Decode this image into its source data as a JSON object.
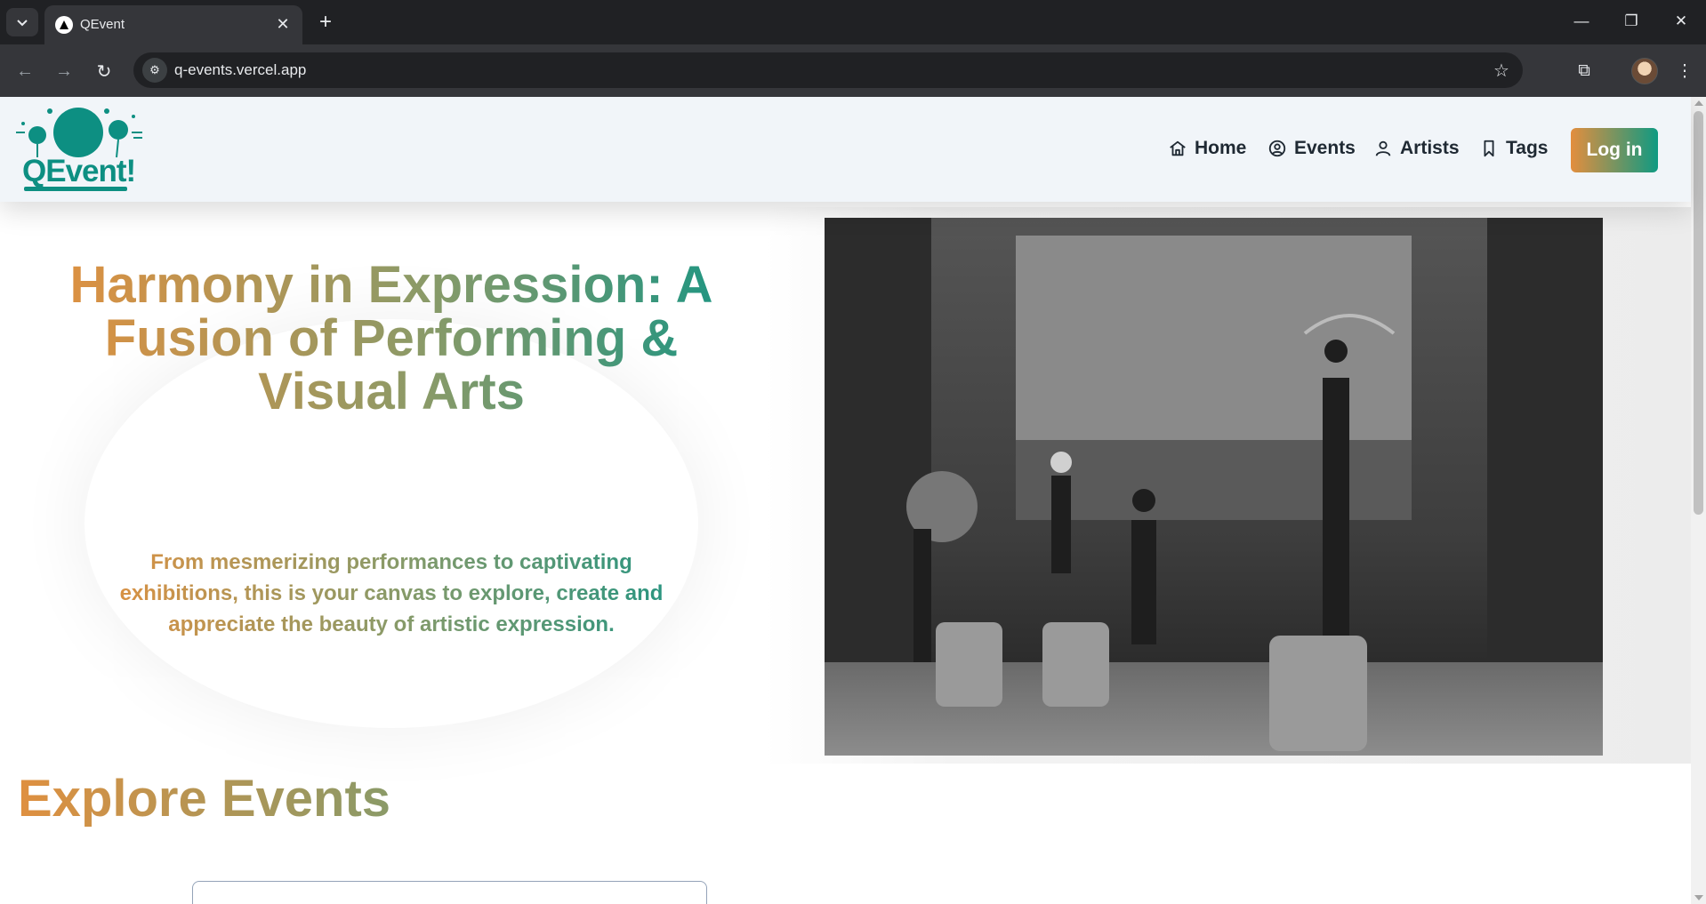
{
  "browser": {
    "tab_title": "QEvent",
    "url": "q-events.vercel.app"
  },
  "site": {
    "logo_text": "QEvent!",
    "nav": [
      {
        "label": "Home",
        "icon": "home-icon"
      },
      {
        "label": "Events",
        "icon": "user-circle-icon"
      },
      {
        "label": "Artists",
        "icon": "user-icon"
      },
      {
        "label": "Tags",
        "icon": "bookmark-icon"
      }
    ],
    "login_label": "Log in"
  },
  "hero": {
    "title": "Harmony in Expression: A Fusion of Performing & Visual Arts",
    "subtitle": "From mesmerizing performances to captivating exhibitions, this is your canvas to explore, create and appreciate the beauty of artistic expression."
  },
  "explore": {
    "heading": "Explore Events"
  },
  "colors": {
    "brand_teal": "#0d8f82",
    "brand_orange": "#e38e3e",
    "header_bg": "#f1f5f9"
  }
}
